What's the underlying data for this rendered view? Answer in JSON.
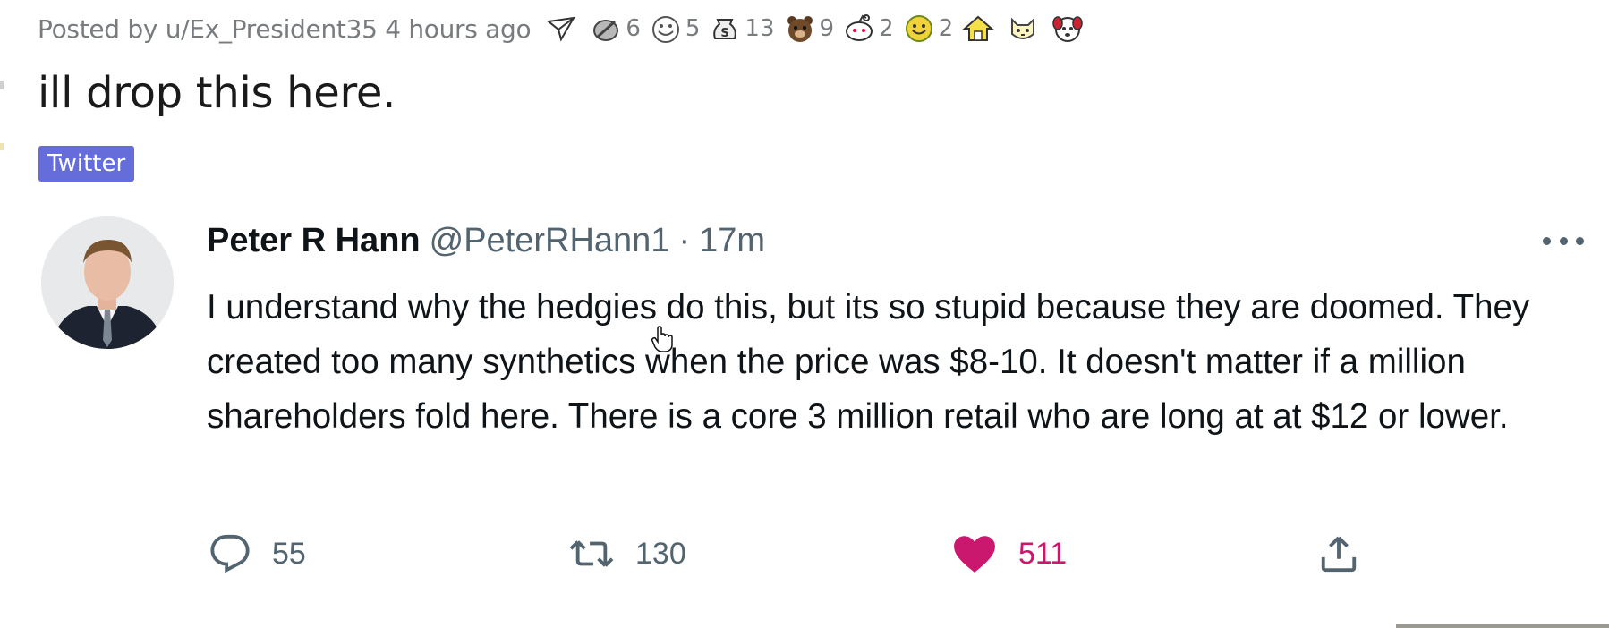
{
  "post": {
    "posted_by": "Posted by u/Ex_President35 4 hours ago",
    "title": "ill drop this here.",
    "flair": "Twitter"
  },
  "awards": [
    {
      "icon": "paper-plane-award-icon",
      "count": ""
    },
    {
      "icon": "silver-award-icon",
      "count": "6"
    },
    {
      "icon": "wholesome-award-icon",
      "count": "5"
    },
    {
      "icon": "money-bag-award-icon",
      "count": "13"
    },
    {
      "icon": "bear-award-icon",
      "count": "9"
    },
    {
      "icon": "snoo-award-icon",
      "count": "2"
    },
    {
      "icon": "take-my-energy-award-icon",
      "count": "2"
    },
    {
      "icon": "home-award-icon",
      "count": ""
    },
    {
      "icon": "cat-award-icon",
      "count": ""
    },
    {
      "icon": "dog-award-icon",
      "count": ""
    }
  ],
  "tweet": {
    "name": "Peter R Hann",
    "handle": "@PeterRHann1",
    "separator": "·",
    "time": "17m",
    "text": "I understand why the hedgies do this, but its so stupid because they are doomed. They created too many synthetics when the price was $8-10. It doesn't matter if a million shareholders fold here. There is a core 3 million retail who are long at at $12 or lower.",
    "replies": "55",
    "retweets": "130",
    "likes": "511"
  },
  "colors": {
    "flair_bg": "#646dd9",
    "like_active": "#c9186d",
    "muted": "#536471"
  }
}
